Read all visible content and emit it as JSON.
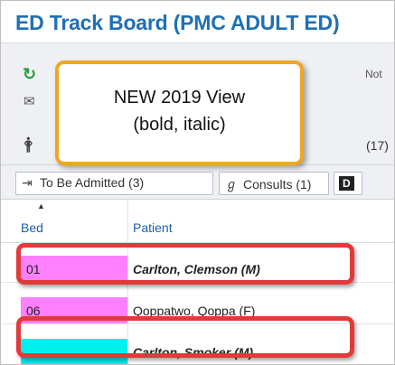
{
  "window": {
    "title": "ED Track Board (PMC ADULT ED)"
  },
  "toolbar": {
    "notes_text": "Not",
    "count_text": "(17)"
  },
  "callout": {
    "line1": "NEW 2019 View",
    "line2": "(bold, italic)",
    "border_color": "#f0a623"
  },
  "tabs": [
    {
      "icon": "admit-arrow-icon",
      "glyph": "⇥",
      "label": "To Be Admitted (3)"
    },
    {
      "icon": "consults-icon",
      "glyph": "ℊ",
      "label": "Consults (1)"
    },
    {
      "icon": "d-icon",
      "glyph": "D",
      "label": ""
    }
  ],
  "grid": {
    "columns": [
      "Bed",
      "Patient"
    ],
    "sort": "ascending",
    "rows": [
      {
        "bed": "01",
        "patient": "Carlton, Clemson (M)",
        "bed_color": "#ff80ff",
        "style": "bold-italic"
      },
      {
        "bed": "06",
        "patient": "Qoppatwo, Qoppa (F)",
        "bed_color": "#ff80ff",
        "style": "normal"
      },
      {
        "bed": "",
        "patient": "Carlton, Smoker (M)",
        "bed_color": "#00f0f0",
        "style": "bold-italic"
      }
    ]
  },
  "colors": {
    "title": "#1f6fb5",
    "highlight_border": "#e03a3a",
    "refresh": "#2e9b3e"
  }
}
